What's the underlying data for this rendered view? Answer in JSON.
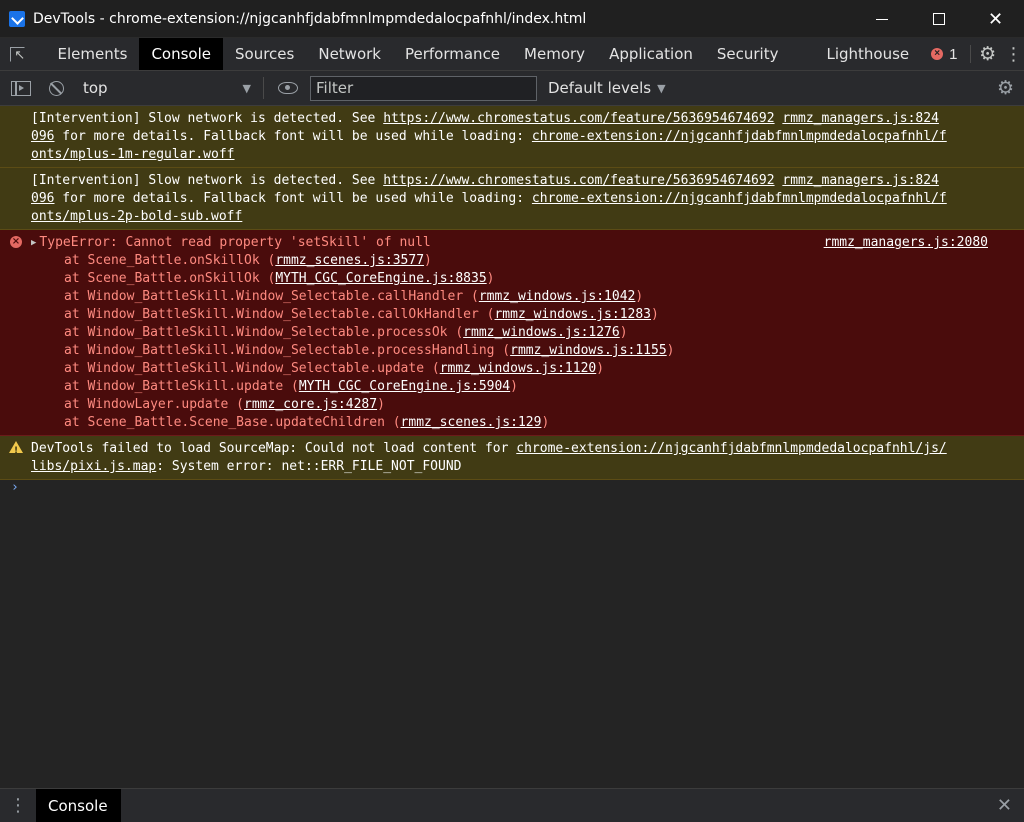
{
  "window": {
    "title": "DevTools - chrome-extension://njgcanhfjdabfmnlmpmdedalocpafnhl/index.html",
    "minimize_icon": "minimize-icon",
    "maximize_icon": "maximize-icon",
    "close_icon": "close-icon"
  },
  "tabs": {
    "items": [
      "Elements",
      "Console",
      "Sources",
      "Network",
      "Performance",
      "Memory",
      "Application",
      "Security",
      "Lighthouse"
    ],
    "active": "Console",
    "error_count": "1"
  },
  "console_toolbar": {
    "context": "top",
    "filter_placeholder": "Filter",
    "levels": "Default levels"
  },
  "messages": {
    "warn1": {
      "prefix": "[Intervention] Slow network is detected. See ",
      "link": "https://www.chromestatus.com/feature/5636954674692",
      "source": "rmmz_managers.js:824",
      "source_cont": "096",
      "middle": " for more details. Fallback font will be used while loading: ",
      "font_link_a": "chrome-extension://njgcanhfjdabfmnlmpmdedalocpafnhl/f",
      "font_link_b": "onts/mplus-1m-regular.woff"
    },
    "warn2": {
      "prefix": "[Intervention] Slow network is detected. See ",
      "link": "https://www.chromestatus.com/feature/5636954674692",
      "source": "rmmz_managers.js:824",
      "source_cont": "096",
      "middle": " for more details. Fallback font will be used while loading: ",
      "font_link_a": "chrome-extension://njgcanhfjdabfmnlmpmdedalocpafnhl/f",
      "font_link_b": "onts/mplus-2p-bold-sub.woff"
    },
    "error": {
      "headline": "TypeError: Cannot read property 'setSkill' of null",
      "source": "rmmz_managers.js:2080",
      "stack": [
        {
          "text": "at Scene_Battle.onSkillOk (",
          "link": "rmmz_scenes.js:3577"
        },
        {
          "text": "at Scene_Battle.onSkillOk (",
          "link": "MYTH_CGC_CoreEngine.js:8835"
        },
        {
          "text": "at Window_BattleSkill.Window_Selectable.callHandler (",
          "link": "rmmz_windows.js:1042"
        },
        {
          "text": "at Window_BattleSkill.Window_Selectable.callOkHandler (",
          "link": "rmmz_windows.js:1283"
        },
        {
          "text": "at Window_BattleSkill.Window_Selectable.processOk (",
          "link": "rmmz_windows.js:1276"
        },
        {
          "text": "at Window_BattleSkill.Window_Selectable.processHandling (",
          "link": "rmmz_windows.js:1155"
        },
        {
          "text": "at Window_BattleSkill.Window_Selectable.update (",
          "link": "rmmz_windows.js:1120"
        },
        {
          "text": "at Window_BattleSkill.update (",
          "link": "MYTH_CGC_CoreEngine.js:5904"
        },
        {
          "text": "at WindowLayer.update (",
          "link": "rmmz_core.js:4287"
        },
        {
          "text": "at Scene_Battle.Scene_Base.updateChildren (",
          "link": "rmmz_scenes.js:129"
        }
      ]
    },
    "warn3": {
      "prefix": "DevTools failed to load SourceMap: Could not load content for ",
      "link_a": "chrome-extension://njgcanhfjdabfmnlmpmdedalocpafnhl/js/",
      "link_b": "libs/pixi.js.map",
      "suffix": ": System error: net::ERR_FILE_NOT_FOUND"
    },
    "prompt": "›"
  },
  "drawer": {
    "tab": "Console"
  },
  "colors": {
    "warn_bg": "#413b14",
    "error_bg": "#4a0c0c",
    "error_text": "#ff8a80",
    "active_tab_bg": "#000000"
  }
}
